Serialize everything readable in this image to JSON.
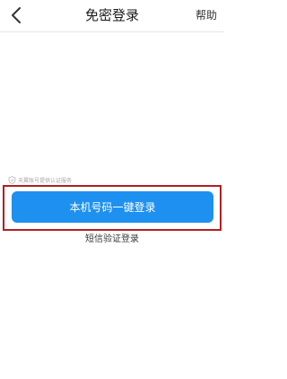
{
  "header": {
    "back_icon": "chevron-left-icon",
    "title": "免密登录",
    "help_label": "帮助"
  },
  "login": {
    "provider_icon": "shield-check-icon",
    "provider_note": "天翼账号提供认证服务",
    "one_tap_label": "本机号码一键登录",
    "sms_label": "短信验证登录"
  },
  "colors": {
    "accent": "#1e90f0",
    "highlight": "#b21f1f",
    "muted_text": "#a8a8a8"
  }
}
